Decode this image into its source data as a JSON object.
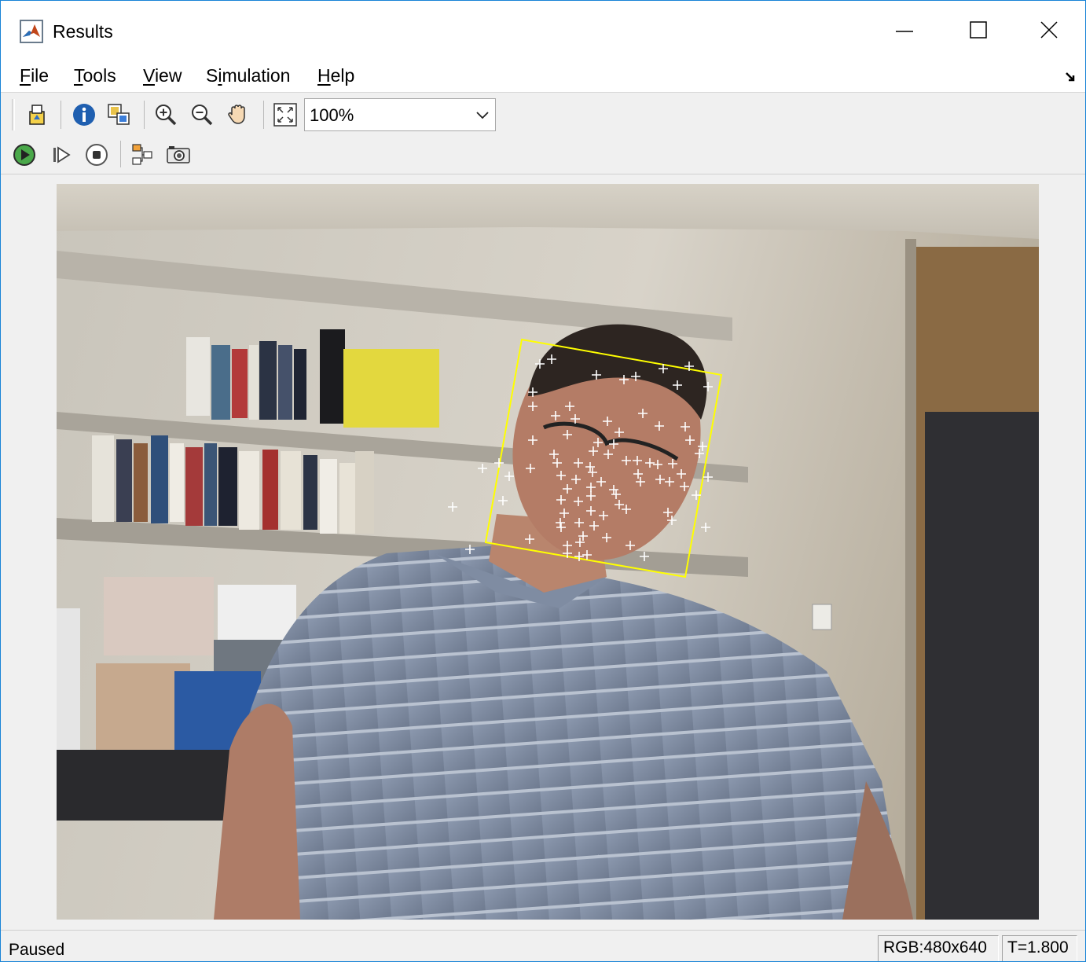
{
  "window": {
    "title": "Results"
  },
  "menu": {
    "file": {
      "ul": "F",
      "rest": "ile"
    },
    "tools": {
      "ul": "T",
      "rest": "ools"
    },
    "view": {
      "ul": "V",
      "rest": "iew"
    },
    "simulation": {
      "pre": "S",
      "ul": "i",
      "rest": "mulation"
    },
    "help": {
      "ul": "H",
      "rest": "elp"
    }
  },
  "toolbar": {
    "zoom_value": "100%",
    "icons": [
      "print-to-figure-icon",
      "info-icon",
      "maintain-fit-icon",
      "zoom-in-icon",
      "zoom-out-icon",
      "pan-hand-icon",
      "fit-to-window-icon"
    ]
  },
  "sim_toolbar": {
    "icons": [
      "run-icon",
      "step-forward-icon",
      "stop-icon",
      "highlight-model-icon",
      "snapshot-camera-icon"
    ]
  },
  "display": {
    "frame_description_colors": {
      "bounding_box": "#ffff00",
      "feature_points": "#ffffff"
    }
  },
  "status": {
    "state": "Paused",
    "dimensions": "RGB:480x640",
    "time": "T=1.800"
  }
}
